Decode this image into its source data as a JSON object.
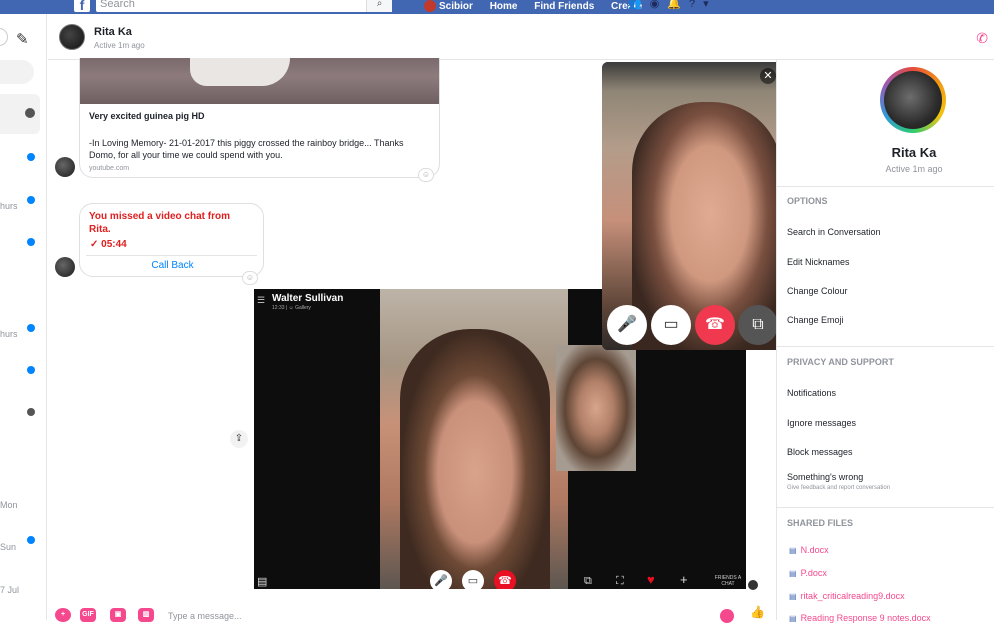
{
  "topbar": {
    "logo": "f",
    "search_placeholder": "Search",
    "search_icon": "search-icon",
    "user_name": "Scibior",
    "nav_home": "Home",
    "nav_find_friends": "Find Friends",
    "nav_create": "Create",
    "icons": [
      "friends-icon",
      "messenger-icon",
      "bell-icon",
      "help-icon",
      "caret-icon"
    ]
  },
  "left": {
    "conv_times": [
      "hurs",
      "hurs",
      "Mon",
      "Sun",
      "7 Jul"
    ]
  },
  "header": {
    "name": "Rita Ka",
    "status": "Active 1m ago"
  },
  "link_card": {
    "title": "Very excited guinea pig HD",
    "description": "-In Loving Memory- 21-01-2017 this piggy crossed the rainboy bridge... Thanks Domo, for all your time we could spend with you.",
    "url": "youtube.com"
  },
  "missed_call": {
    "text": "You missed a video chat from Rita.",
    "duration": "05:44",
    "action": "Call Back"
  },
  "skype_overlay": {
    "name": "Walter Sullivan",
    "sub": "12:33 | ☺ Gallery",
    "friends_tag": "FRIENDS A CHAT"
  },
  "video_popup": {
    "buttons": [
      "mic-icon",
      "camera-icon",
      "hangup-icon",
      "popout-icon"
    ]
  },
  "right": {
    "name": "Rita Ka",
    "status": "Active 1m ago",
    "options_title": "OPTIONS",
    "options": [
      "Search in Conversation",
      "Edit Nicknames",
      "Change Colour",
      "Change Emoji"
    ],
    "privacy_title": "PRIVACY AND SUPPORT",
    "privacy": [
      "Notifications",
      "Ignore messages",
      "Block messages",
      "Something's wrong"
    ],
    "privacy_sub": "Give feedback and report conversation",
    "files_title": "SHARED FILES",
    "files": [
      "N.docx",
      "P.docx",
      "ritak_criticalreading9.docx",
      "Reading Response 9 notes.docx"
    ]
  },
  "composer": {
    "placeholder": "Type a message...",
    "gif_label": "GIF"
  },
  "colors": {
    "fb_blue": "#4267b2",
    "accent_pink": "#f5488d",
    "missed_red": "#e02020",
    "link_blue": "#0084ff"
  }
}
